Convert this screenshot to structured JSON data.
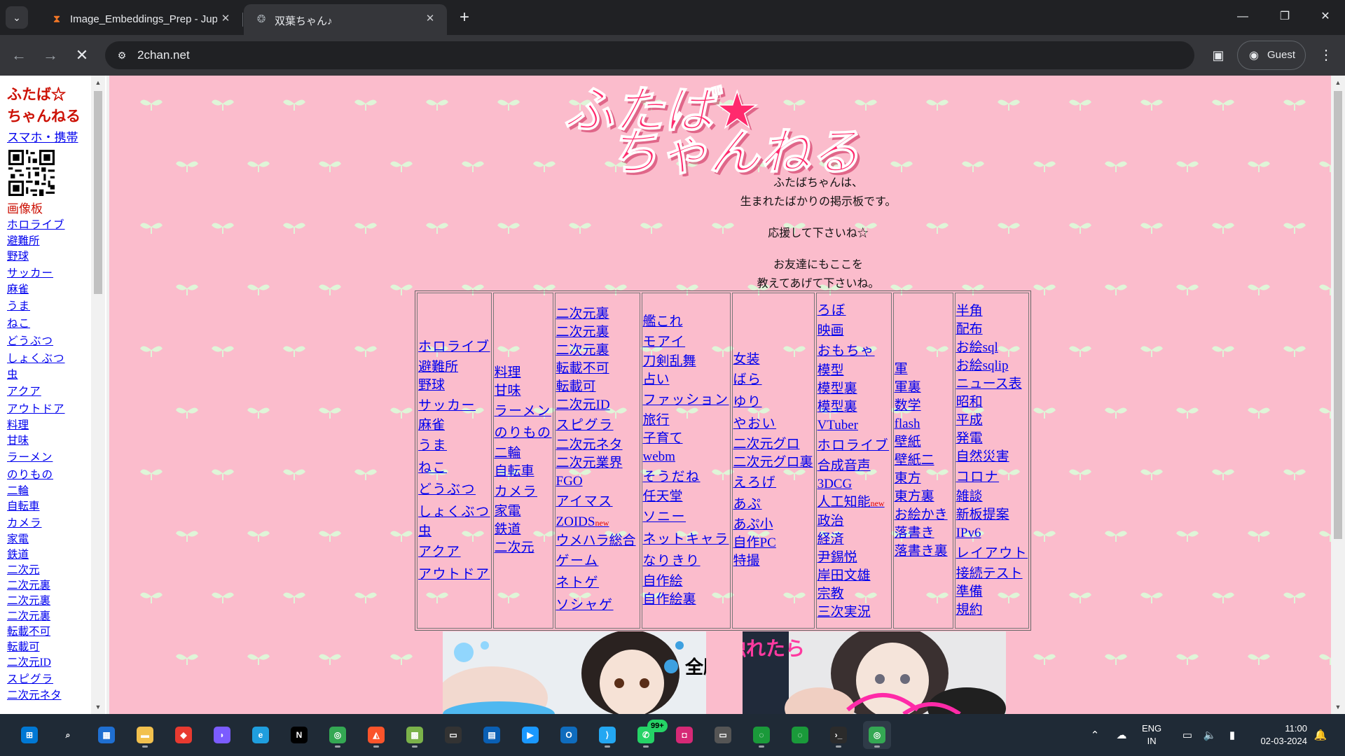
{
  "browser": {
    "tabs": [
      {
        "title": "Image_Embeddings_Prep - Jupy",
        "favicon": "hourglass-icon",
        "active": false
      },
      {
        "title": "双葉ちゃん♪",
        "favicon": "futaba-icon",
        "active": true
      }
    ],
    "url": "2chan.net",
    "profile_label": "Guest"
  },
  "side": {
    "brand_line1": "ふたば☆",
    "brand_line2": "ちゃんねる",
    "mobile_link": "スマホ・携帯",
    "board_title": "画像板",
    "links": [
      "ホロライブ",
      "避難所",
      "野球",
      "サッカー",
      "麻雀",
      "うま",
      "ねこ",
      "どうぶつ",
      "しょくぶつ",
      "虫",
      "アクア",
      "アウトドア",
      "料理",
      "甘味",
      "ラーメン",
      "のりもの",
      "二輪",
      "自転車",
      "カメラ",
      "家電",
      "鉄道",
      "二次元",
      "二次元裏",
      "二次元裏",
      "二次元裏",
      "転載不可",
      "転載可",
      "二次元ID",
      "スピグラ",
      "二次元ネタ"
    ]
  },
  "main": {
    "logo_line1": "ふたば★",
    "logo_line2": "ちゃんねる",
    "tagline": [
      "ふたばちゃんは、",
      "生まれたばかりの掲示板です。",
      "",
      "応援して下さいね☆",
      "",
      "お友達にもここを",
      "教えてあげて下さいね。"
    ],
    "new_label": "new",
    "columns": [
      [
        "ホロライブ",
        "避難所",
        "野球",
        "サッカー",
        "麻雀",
        "うま",
        "ねこ",
        "どうぶつ",
        "しょくぶつ",
        "虫",
        "アクア",
        "アウトドア"
      ],
      [
        "料理",
        "甘味",
        "ラーメン",
        "のりもの",
        "二輪",
        "自転車",
        "カメラ",
        "家電",
        "鉄道",
        "二次元"
      ],
      [
        "二次元裏",
        "二次元裏",
        "二次元裏",
        "転載不可",
        "転載可",
        "二次元ID",
        "スピグラ",
        "二次元ネタ",
        "二次元業界",
        "FGO",
        "アイマス",
        "ZOIDS",
        "ウメハラ総合",
        "ゲーム",
        "ネトゲ",
        "ソシャゲ"
      ],
      [
        "艦これ",
        "モアイ",
        "刀剣乱舞",
        "占い",
        "ファッション",
        "旅行",
        "子育て",
        "webm",
        "そうだね",
        "任天堂",
        "ソニー",
        "ネットキャラ",
        "なりきり",
        "自作絵",
        "自作絵裏"
      ],
      [
        "女装",
        "ばら",
        "ゆり",
        "やおい",
        "二次元グロ",
        "二次元グロ裏",
        "えろげ",
        "あぷ",
        "あぷ小",
        "自作PC",
        "特撮"
      ],
      [
        "ろぼ",
        "映画",
        "おもちゃ",
        "模型",
        "模型裏",
        "模型裏",
        "VTuber",
        "ホロライブ",
        "合成音声",
        "3DCG",
        "人工知能",
        "政治",
        "経済",
        "尹錫悦",
        "岸田文雄",
        "宗教",
        "三次実況"
      ],
      [
        "軍",
        "軍裏",
        "数学",
        "flash",
        "壁紙",
        "壁紙二",
        "東方",
        "東方裏",
        "お絵かき",
        "落書き",
        "落書き裏"
      ],
      [
        "半角",
        "配布",
        "お絵sql",
        "お絵sqlip",
        "ニュース表",
        "昭和",
        "平成",
        "発電",
        "自然災害",
        "コロナ",
        "雑談",
        "新板提案",
        "IPv6",
        "レイアウト",
        "接続テスト",
        "準備",
        "規約"
      ]
    ],
    "new_items": [
      "ZOIDS",
      "人工知能"
    ],
    "ad_banner_2_text": "触れたら",
    "ad_banner_1_text": "全胸"
  },
  "taskbar": {
    "apps": [
      "start-icon",
      "search-icon",
      "store-icon",
      "file-explorer-icon",
      "office-icon",
      "copilot-icon",
      "edge-icon",
      "netflix-icon",
      "chrome-icon",
      "brave-icon",
      "minecraft-icon",
      "terminal-icon",
      "vscode-server-icon",
      "prime-video-icon",
      "outlook-icon",
      "vscode-icon",
      "whatsapp-icon",
      "instagram-icon",
      "console-icon",
      "ring-app-icon",
      "ring-app2-icon",
      "powershell-icon",
      "chrome-active-icon"
    ],
    "whatsapp_badge": "99+",
    "lang_line1": "ENG",
    "lang_line2": "IN",
    "time": "11:00",
    "date": "02-03-2024"
  },
  "colors": {
    "page_bg": "#fbbccc",
    "link": "#0000ee",
    "brand_red": "#cc1105",
    "logo_pink": "#ff2a6d"
  }
}
